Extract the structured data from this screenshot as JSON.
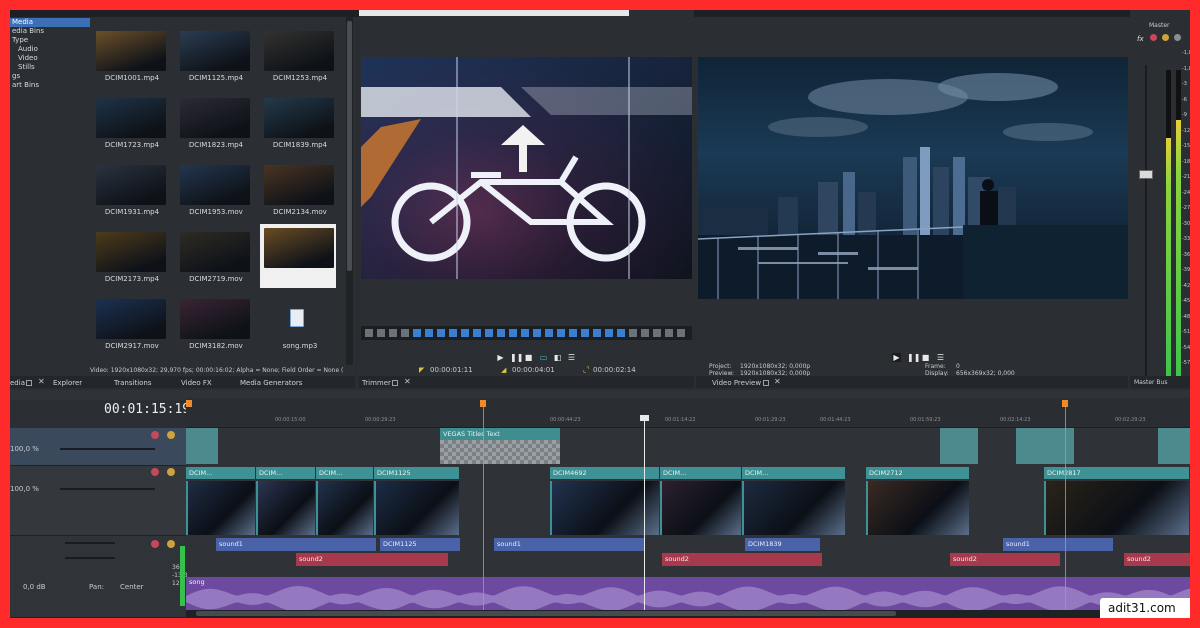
{
  "media_tree": {
    "items": [
      "Media",
      "edia Bins",
      "Type",
      "Audio",
      "Video",
      "Stills",
      "gs",
      "art Bins"
    ],
    "selected": 0
  },
  "media_files": [
    {
      "name": "DCIM1001.mp4",
      "color": "#6b4f2a"
    },
    {
      "name": "DCIM1125.mp4",
      "color": "#2b3d52"
    },
    {
      "name": "DCIM1253.mp4",
      "color": "#33322f"
    },
    {
      "name": "DCIM1723.mp4",
      "color": "#1f3347"
    },
    {
      "name": "DCIM1823.mp4",
      "color": "#2c2a35"
    },
    {
      "name": "DCIM1839.mp4",
      "color": "#233a4a"
    },
    {
      "name": "DCIM1931.mp4",
      "color": "#2a3340"
    },
    {
      "name": "DCIM1953.mov",
      "color": "#23364f"
    },
    {
      "name": "DCIM2134.mov",
      "color": "#4a3422"
    },
    {
      "name": "DCIM2173.mp4",
      "color": "#4d3b1c"
    },
    {
      "name": "DCIM2719.mov",
      "color": "#2e2b24"
    },
    {
      "name": "",
      "color": "#6a4c24"
    },
    {
      "name": "DCIM2917.mov",
      "color": "#1b3152"
    },
    {
      "name": "DCIM3182.mov",
      "color": "#3a2434"
    },
    {
      "name": "song.mp3",
      "color": ""
    }
  ],
  "media_status": "Video: 1920x1080x32; 29,970 fps; 00:00:16:02; Alpha = None; Field Order = None (",
  "left_tabs": [
    "edia",
    "Explorer",
    "Transitions",
    "Video FX",
    "Media Generators"
  ],
  "trimmer": {
    "title": "Trimmer",
    "header": "",
    "time_in": "00:00:01:11",
    "time_len": "00:00:04:01",
    "time_out": "00:00:02:14"
  },
  "preview": {
    "title": "Video Preview",
    "project_label": "Project:",
    "project_value": "1920x1080x32; 0,000p",
    "preview_label": "Preview:",
    "preview_value": "1920x1080x32; 0,000p",
    "frame_label": "Frame:",
    "frame_value": "0",
    "display_label": "Display:",
    "display_value": "656x369x32; 0,000"
  },
  "master": {
    "title": "Master",
    "tab": "Master Bus",
    "scale": [
      "-1,8",
      "-1,8",
      "-3",
      "-6",
      "-9",
      "-12",
      "-15",
      "-18",
      "-21",
      "-24",
      "-27",
      "-30",
      "-33",
      "-36",
      "-39",
      "-42",
      "-45",
      "-48",
      "-51",
      "-54",
      "-57"
    ],
    "level_left": 0.78,
    "level_right": 0.84
  },
  "timeline": {
    "timecode": "00:01:15:19",
    "ruler": [
      "00:00:15:00",
      "00:00:29:23",
      "00:00:44:23",
      "00:01:14:22",
      "00:01:29:23",
      "00:01:44:23",
      "00:01:59:23",
      "00:02:14:23",
      "00:02:29:23"
    ],
    "track1_level": "100,0 %",
    "track2_level": "100,0 %",
    "audio_db": "0,0 dB",
    "pan_label": "Pan:",
    "pan_value": "Center",
    "meter_vals": [
      "36",
      "-13,3",
      "12"
    ],
    "titles_clip": "VEGAS Titles Text",
    "video_clips": [
      "DCIM...",
      "DCIM...",
      "DCIM...",
      "DCIM1125",
      "DCIM4692",
      "DCIM...",
      "DCIM...",
      "DCIM2712",
      "DCIM2817"
    ],
    "audio_clips_1": [
      "sound1",
      "DCIM1125",
      "sound1",
      "DCIM1839",
      "sound1"
    ],
    "audio_clips_2": [
      "sound2",
      "sound2",
      "sound2",
      "sound2"
    ],
    "song_clip": "song"
  },
  "watermark": "adit31.com"
}
